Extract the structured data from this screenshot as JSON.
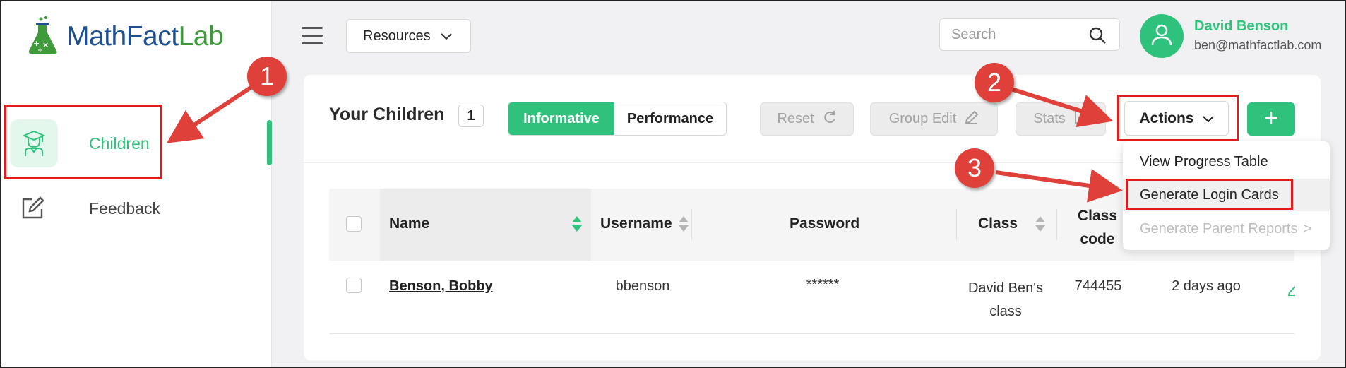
{
  "logo": {
    "part1": "MathFact",
    "part2": "Lab"
  },
  "sidebar": {
    "items": [
      {
        "label": "Children",
        "icon": "student-icon",
        "active": true
      },
      {
        "label": "Feedback",
        "icon": "edit-icon",
        "active": false
      }
    ]
  },
  "header": {
    "resources_label": "Resources",
    "search_placeholder": "Search",
    "user": {
      "name": "David Benson",
      "email": "ben@mathfactlab.com"
    }
  },
  "toolbar": {
    "title": "Your Children",
    "count": "1",
    "view_toggle": [
      "Informative",
      "Performance"
    ],
    "active_view": "Informative",
    "reset_label": "Reset",
    "group_edit_label": "Group Edit",
    "stats_label": "Stats",
    "actions_label": "Actions",
    "add_label": "+"
  },
  "actions_menu": [
    {
      "label": "View Progress Table",
      "state": "normal"
    },
    {
      "label": "Generate Login Cards",
      "state": "highlighted"
    },
    {
      "label": "Generate Parent Reports",
      "state": "disabled",
      "submenu_arrow": ">"
    }
  ],
  "table": {
    "columns": [
      "Name",
      "Username",
      "Password",
      "Class",
      "Class code"
    ],
    "rows": [
      {
        "name": "Benson, Bobby",
        "username": "bbenson",
        "password": "******",
        "class": "David Ben's class",
        "class_code": "744455",
        "last_active": "2 days ago"
      }
    ]
  },
  "annotations": {
    "callouts": [
      "1",
      "2",
      "3"
    ],
    "color": "#e01b1b"
  },
  "colors": {
    "accent": "#2fc27d",
    "logo_blue": "#1d4f91",
    "logo_green": "#3f9a3b"
  }
}
